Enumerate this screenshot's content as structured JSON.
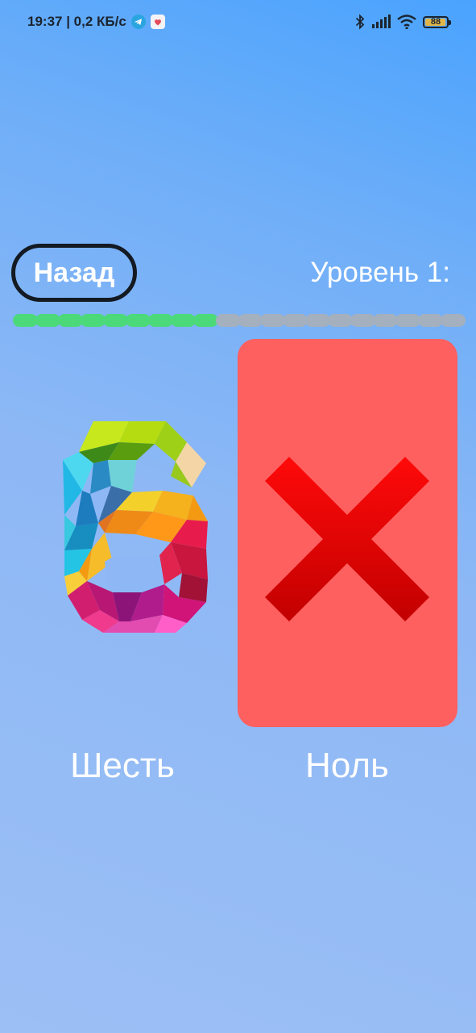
{
  "status_bar": {
    "time_speed": "19:37 | 0,2 КБ/с",
    "icons_left": [
      "telegram-icon",
      "app-notification-icon"
    ],
    "icons_right": [
      "bluetooth-icon",
      "signal-icon",
      "wifi-icon",
      "battery-icon"
    ],
    "battery": "88",
    "battery_level": 0.88
  },
  "header": {
    "back_label": "Назад",
    "level_label": "Уровень 1:"
  },
  "progress": {
    "completed": 9,
    "total": 20
  },
  "cards": {
    "left": {
      "caption": "Шесть",
      "icon": "digit-six-icon"
    },
    "right": {
      "caption": "Ноль",
      "icon": "cross-icon",
      "state": "wrong"
    }
  },
  "colors": {
    "progress_done": "#4cd97a",
    "progress_todo": "#a4b0bd",
    "wrong_card": "#fe6060",
    "cross": "#e00000"
  }
}
